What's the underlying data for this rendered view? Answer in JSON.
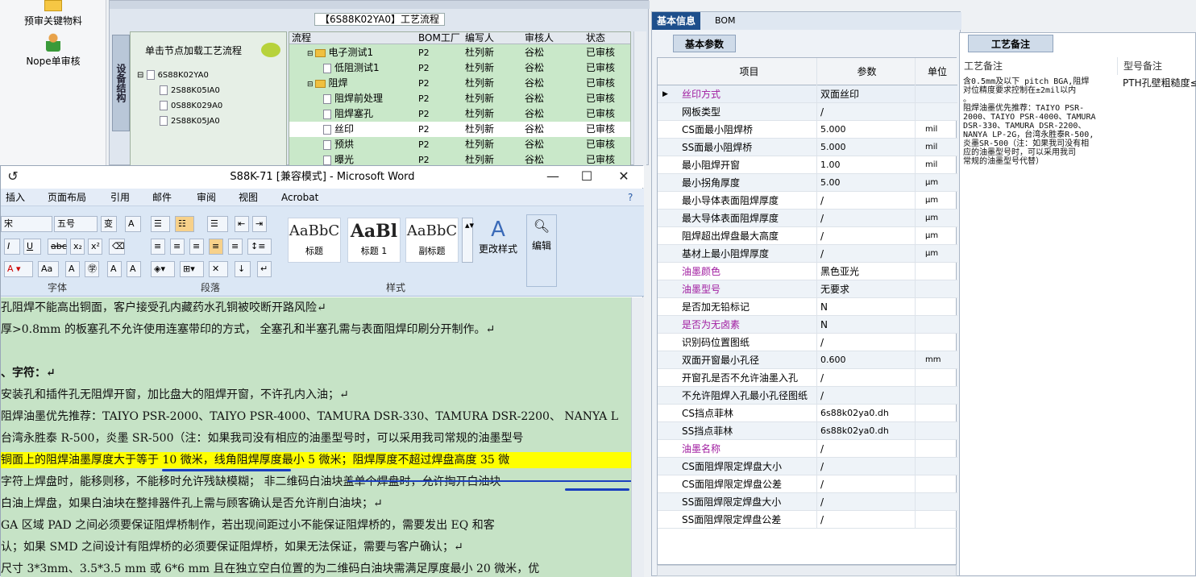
{
  "left_nav": {
    "items": [
      {
        "label": "预审关键物料",
        "icon": "folder-icon"
      },
      {
        "label": "Nope单审核",
        "icon": "user-icon"
      }
    ]
  },
  "process": {
    "title": "【6S88K02YA0】工艺流程",
    "side_tab": "设备结构",
    "hint": "单击节点加载工艺流程",
    "tree": [
      "6S88K02YA0",
      "2S88K05IA0",
      "0S88K029A0",
      "2S88K05JA0"
    ],
    "columns": [
      "流程",
      "BOM工厂",
      "编写人",
      "审核人",
      "状态"
    ],
    "rows": [
      {
        "name": "电子测试1",
        "folder": true,
        "plant": "P2",
        "author": "杜列新",
        "reviewer": "谷松",
        "status": "已审核"
      },
      {
        "name": "低阻测试1",
        "folder": false,
        "plant": "P2",
        "author": "杜列新",
        "reviewer": "谷松",
        "status": "已审核"
      },
      {
        "name": "阻焊",
        "folder": true,
        "plant": "P2",
        "author": "杜列新",
        "reviewer": "谷松",
        "status": "已审核"
      },
      {
        "name": "阻焊前处理",
        "folder": false,
        "plant": "P2",
        "author": "杜列新",
        "reviewer": "谷松",
        "status": "已审核"
      },
      {
        "name": "阻焊塞孔",
        "folder": false,
        "plant": "P2",
        "author": "杜列新",
        "reviewer": "谷松",
        "status": "已审核"
      },
      {
        "name": "丝印",
        "folder": false,
        "plant": "P2",
        "author": "杜列新",
        "reviewer": "谷松",
        "status": "已审核",
        "selected": true
      },
      {
        "name": "预烘",
        "folder": false,
        "plant": "P2",
        "author": "杜列新",
        "reviewer": "谷松",
        "status": "已审核"
      },
      {
        "name": "曝光",
        "folder": false,
        "plant": "P2",
        "author": "杜列新",
        "reviewer": "谷松",
        "status": "已审核"
      }
    ]
  },
  "word": {
    "title": "S88K-71 [兼容模式] - Microsoft Word",
    "menu": [
      "插入",
      "页面布局",
      "引用",
      "邮件",
      "审阅",
      "视图",
      "Acrobat"
    ],
    "font_size": "五号",
    "font_name": "宋",
    "styles": [
      {
        "sample": "AaBbC",
        "name": "标题"
      },
      {
        "sample": "AaBl",
        "name": "标题 1"
      },
      {
        "sample": "AaBbC",
        "name": "副标题"
      }
    ],
    "change_styles": "更改样式",
    "edit": "编辑",
    "groups": [
      "字体",
      "段落",
      "样式"
    ],
    "lines": [
      "孔阻焊不能高出铜面，客户接受孔内藏药水孔铜被咬断开路风险↵",
      "厚>0.8mm 的板塞孔不允许使用连塞带印的方式，  全塞孔和半塞孔需与表面阻焊印刷分开制作。↵",
      "",
      "、字符：↵",
      "安装孔和插件孔无阻焊开窗，加比盘大的阻焊开窗，不许孔内入油；↵",
      "阻焊油墨优先推荐：TAIYO PSR-2000、TAIYO PSR-4000、TAMURA   DSR-330、TAMURA DSR-2200、 NANYA L",
      "台湾永胜泰 R-500，炎墨 SR-500（注：如果我司没有相应的油墨型号时，可以采用我司常规的油墨型号",
      "铜面上的阻焊油墨厚度大于等于 10 微米，线角阻焊厚度最小 5 微米；阻焊厚度不超过焊盘高度 35 微",
      "字符上焊盘时，能移则移，不能移时允许残缺模糊；  非二维码白油块盖单个焊盘时，允许掏开白油块",
      "白油上焊盘，如果白油块在整排器件孔上需与顾客确认是否允许削白油块；↵",
      "GA 区域 PAD 之间必须要保证阻焊桥制作，若出现间距过小不能保证阻焊桥的，需要发出 EQ 和客",
      "认；如果 SMD 之间设计有阻焊桥的必须要保证阻焊桥，如果无法保证，需要与客户确认；↵",
      "尺寸 3*3mm、3.5*3.5 mm 或 6*6 mm 且在独立空白位置的为二维码白油块需满足厚度最小 20 微米，优"
    ]
  },
  "basic": {
    "tabs": [
      "基本信息",
      "BOM"
    ],
    "subtab": "基本参数",
    "columns": [
      "项目",
      "参数",
      "单位"
    ],
    "rows": [
      {
        "item": "丝印方式",
        "param": "双面丝印",
        "unit": "",
        "purple": true
      },
      {
        "item": "网板类型",
        "param": "/",
        "unit": ""
      },
      {
        "item": "CS面最小阻焊桥",
        "param": "5.000",
        "unit": "mil"
      },
      {
        "item": "SS面最小阻焊桥",
        "param": "5.000",
        "unit": "mil"
      },
      {
        "item": "最小阻焊开窗",
        "param": "1.00",
        "unit": "mil"
      },
      {
        "item": "最小拐角厚度",
        "param": "5.00",
        "unit": "μm"
      },
      {
        "item": "最小导体表面阻焊厚度",
        "param": "/",
        "unit": "μm"
      },
      {
        "item": "最大导体表面阻焊厚度",
        "param": "/",
        "unit": "μm"
      },
      {
        "item": "阻焊超出焊盘最大高度",
        "param": "/",
        "unit": "μm"
      },
      {
        "item": "基材上最小阻焊厚度",
        "param": "/",
        "unit": "μm"
      },
      {
        "item": "油墨颜色",
        "param": "黑色亚光",
        "unit": "",
        "purple": true
      },
      {
        "item": "油墨型号",
        "param": "无要求",
        "unit": "",
        "purple": true
      },
      {
        "item": "是否加无铅标记",
        "param": "N",
        "unit": ""
      },
      {
        "item": "是否为无卤素",
        "param": "N",
        "unit": "",
        "purple": true
      },
      {
        "item": "识别码位置图纸",
        "param": "/",
        "unit": ""
      },
      {
        "item": "双面开窗最小孔径",
        "param": "0.600",
        "unit": "mm"
      },
      {
        "item": "开窗孔是否不允许油墨入孔",
        "param": "/",
        "unit": ""
      },
      {
        "item": "不允许阻焊入孔最小孔径图纸",
        "param": "/",
        "unit": ""
      },
      {
        "item": "CS挡点菲林",
        "param": "6s88k02ya0.dh",
        "unit": ""
      },
      {
        "item": "SS挡点菲林",
        "param": "6s88k02ya0.dh",
        "unit": ""
      },
      {
        "item": "油墨名称",
        "param": "/",
        "unit": "",
        "purple": true
      },
      {
        "item": "CS面阻焊限定焊盘大小",
        "param": "/",
        "unit": ""
      },
      {
        "item": "CS面阻焊限定焊盘公差",
        "param": "/",
        "unit": ""
      },
      {
        "item": "SS面阻焊限定焊盘大小",
        "param": "/",
        "unit": ""
      },
      {
        "item": "SS面阻焊限定焊盘公差",
        "param": "/",
        "unit": ""
      }
    ]
  },
  "notes": {
    "tab": "工艺备注",
    "col1": "工艺备注",
    "col2": "型号备注",
    "text1": "含0.5mm及以下 pitch BGA,阻焊\n对位精度要求控制在±2mil以内\n。\n阻焊油墨优先推荐：TAIYO PSR-\n2000、TAIYO PSR-4000、TAMURA\nDSR-330、TAMURA DSR-2200、\nNANYA LP-2G，台湾永胜泰R-500,\n炎墨SR-500（注：如果我司没有相\n应的油墨型号时，可以采用我司\n常规的油墨型号代替）",
    "text2": "PTH孔壁粗糙度≤"
  }
}
